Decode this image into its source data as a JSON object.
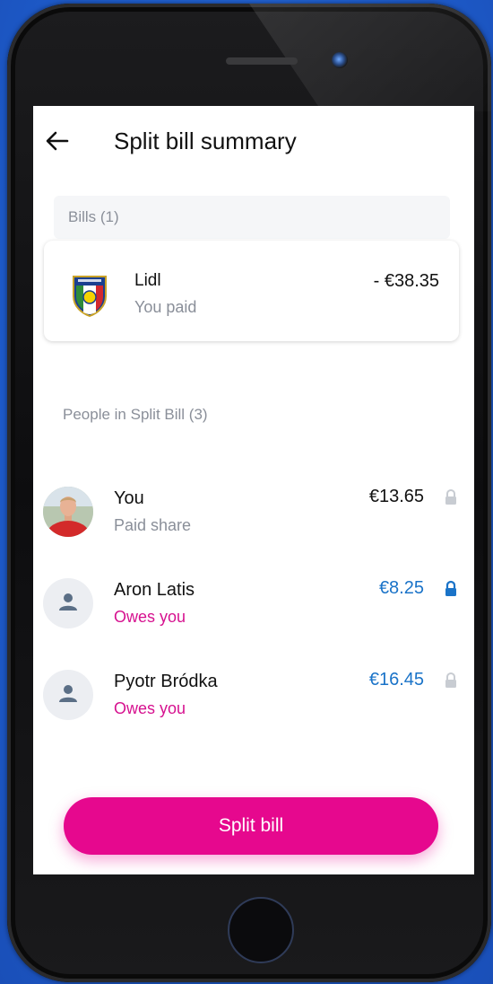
{
  "header": {
    "title": "Split bill summary",
    "back_icon": "arrow-left-icon"
  },
  "bills": {
    "section_label": "Bills (1)",
    "items": [
      {
        "merchant": "Lidl",
        "subtitle": "You paid",
        "amount": "- €38.35",
        "icon": "lidl-shield-logo"
      }
    ]
  },
  "people": {
    "section_label": "People in Split Bill (3)",
    "items": [
      {
        "name": "You",
        "status": "Paid share",
        "amount": "€13.65",
        "locked": false,
        "status_color": "#8a8f99",
        "amount_color": "#111111"
      },
      {
        "name": "Aron Latis",
        "status": "Owes you",
        "amount": "€8.25",
        "locked": true,
        "status_color": "#d6118f",
        "amount_color": "#1a73c8"
      },
      {
        "name": "Pyotr Bródka",
        "status": "Owes you",
        "amount": "€16.45",
        "locked": false,
        "status_color": "#d6118f",
        "amount_color": "#1a73c8"
      }
    ]
  },
  "actions": {
    "split_label": "Split bill"
  },
  "colors": {
    "accent": "#e6088e",
    "link_blue": "#1a73c8",
    "owes_pink": "#d6118f"
  }
}
